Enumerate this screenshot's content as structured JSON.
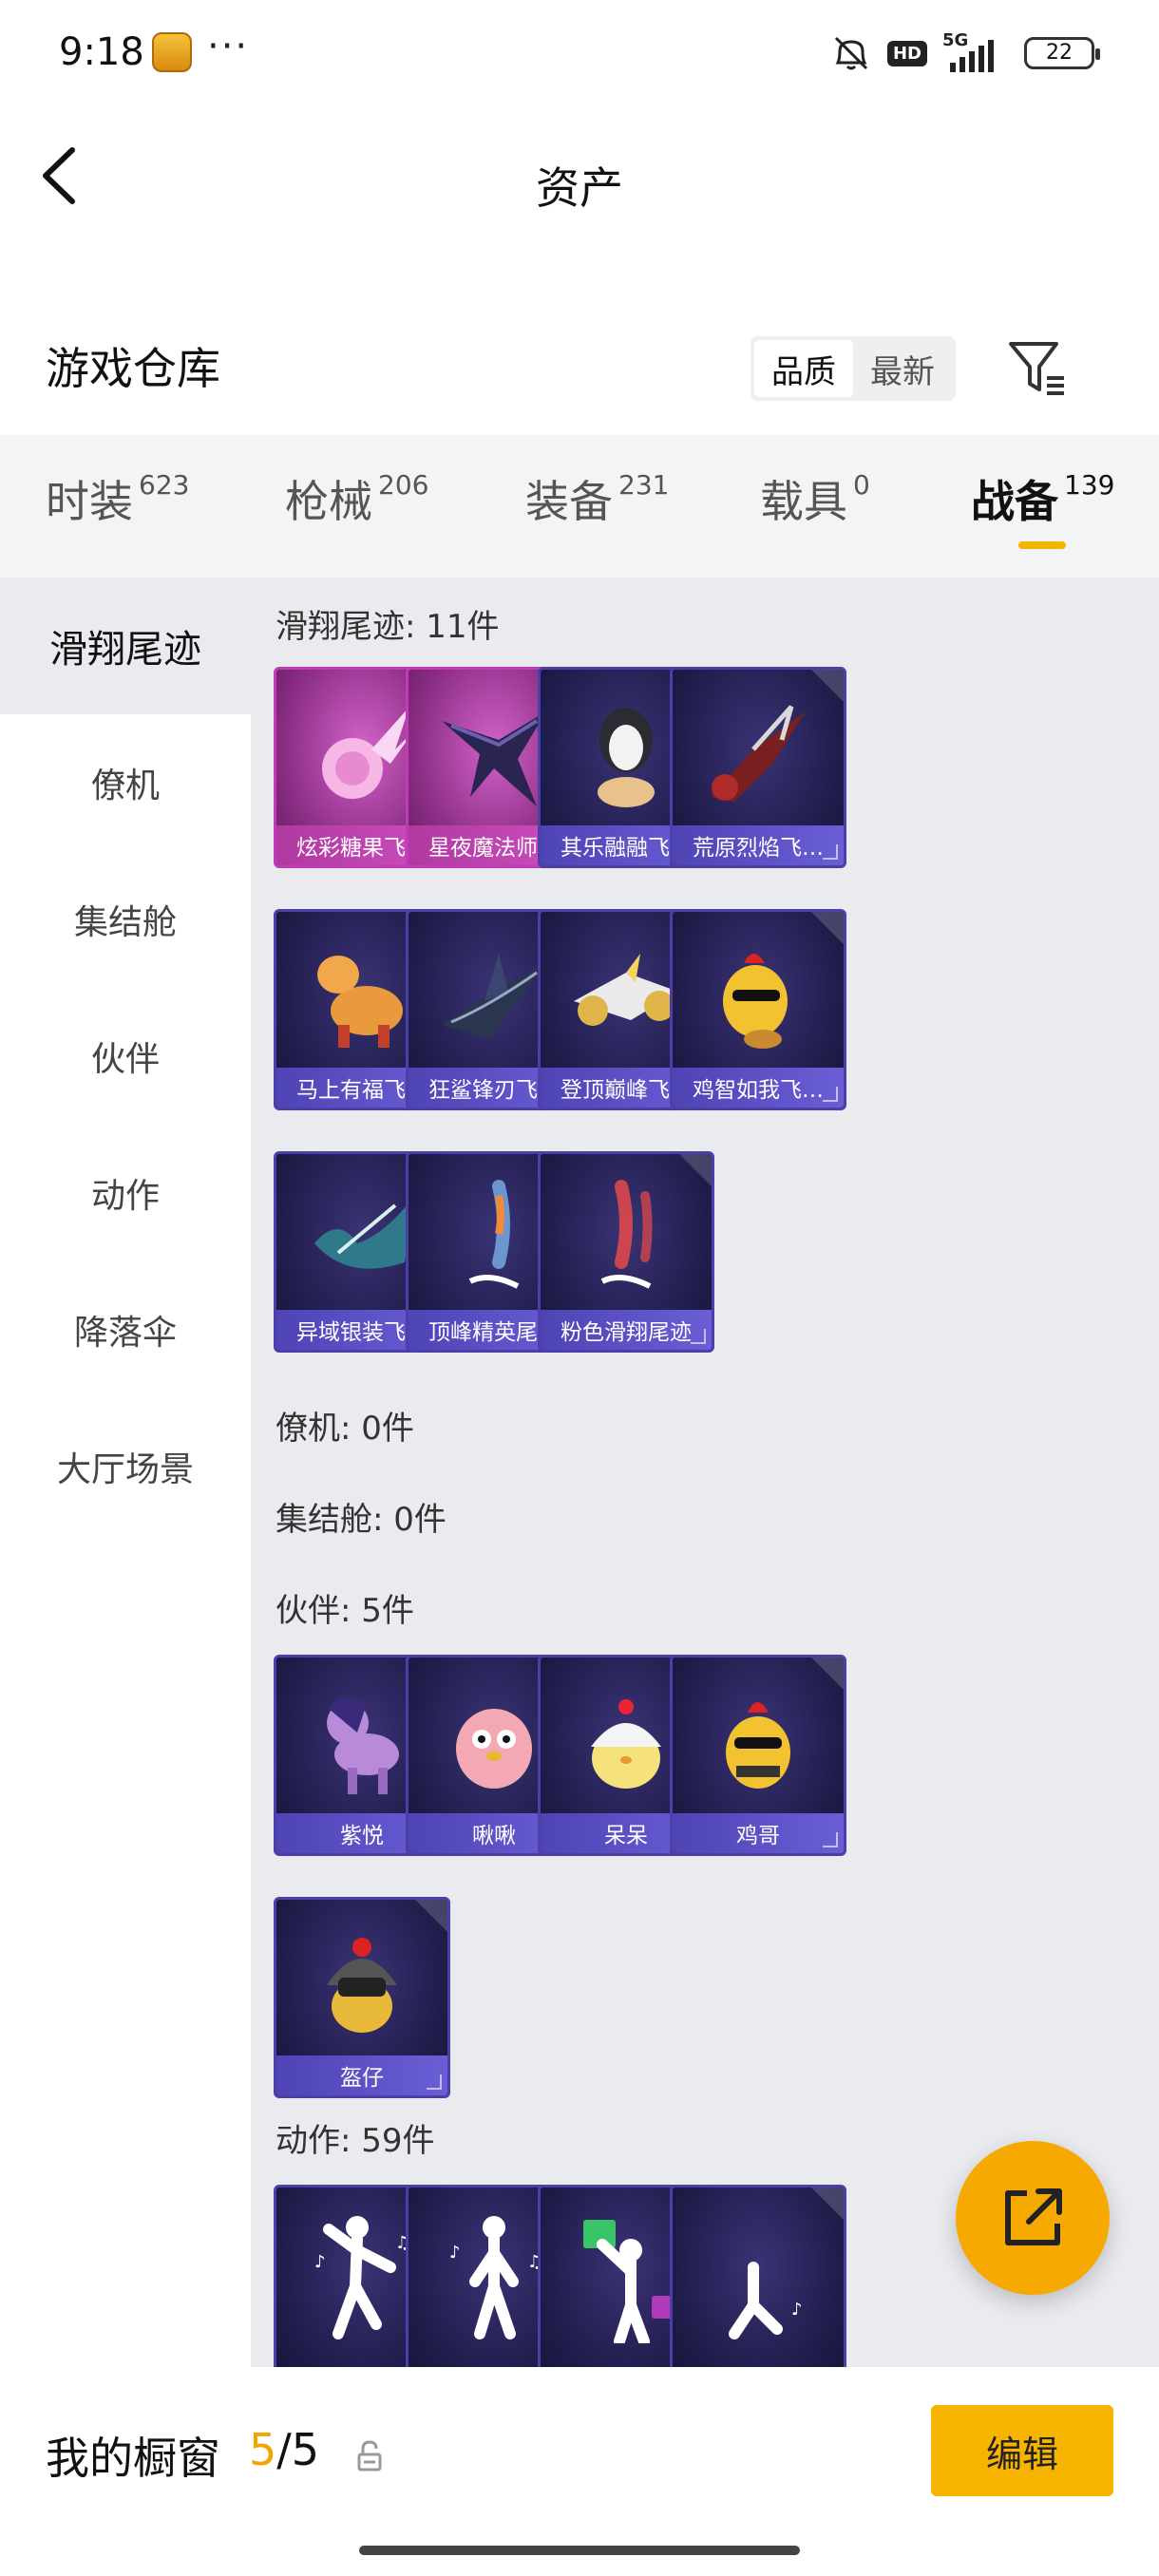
{
  "status_bar": {
    "time": "9:18",
    "dots": "···",
    "hd": "HD",
    "network": "5G",
    "battery": "22"
  },
  "header": {
    "title": "资产"
  },
  "warehouse": {
    "title": "游戏仓库",
    "sort_options": [
      "品质",
      "最新"
    ],
    "active_sort": 0
  },
  "category_tabs": [
    {
      "label": "时装",
      "count": "623"
    },
    {
      "label": "枪械",
      "count": "206"
    },
    {
      "label": "装备",
      "count": "231"
    },
    {
      "label": "载具",
      "count": "0"
    },
    {
      "label": "战备",
      "count": "139",
      "active": true
    }
  ],
  "sidebar": {
    "items": [
      "滑翔尾迹",
      "僚机",
      "集结舱",
      "伙伴",
      "动作",
      "降落伞",
      "大厅场景"
    ],
    "active": 0
  },
  "sections": {
    "glide": {
      "title": "滑翔尾迹: 11件",
      "items": [
        "炫彩糖果飞…",
        "星夜魔法师…",
        "其乐融融飞…",
        "荒原烈焰飞…",
        "马上有福飞…",
        "狂鲨锋刃飞…",
        "登顶巅峰飞…",
        "鸡智如我飞…",
        "异域银装飞…",
        "顶峰精英尾迹",
        "粉色滑翔尾迹"
      ]
    },
    "wingman": {
      "title": "僚机: 0件"
    },
    "pod": {
      "title": "集结舱: 0件"
    },
    "partner": {
      "title": "伙伴: 5件",
      "items": [
        "紫悦",
        "啾啾",
        "呆呆",
        "鸡哥",
        "盔仔"
      ]
    },
    "emote": {
      "title": "动作: 59件",
      "items": [
        "",
        "",
        "",
        ""
      ]
    }
  },
  "bottom_bar": {
    "label": "我的橱窗",
    "count_current": "5",
    "count_total": "/5",
    "edit_label": "编辑"
  },
  "colors": {
    "accent": "#f6b400",
    "card_border": "#4c3fa8",
    "card_pink": "#c23ab8"
  }
}
